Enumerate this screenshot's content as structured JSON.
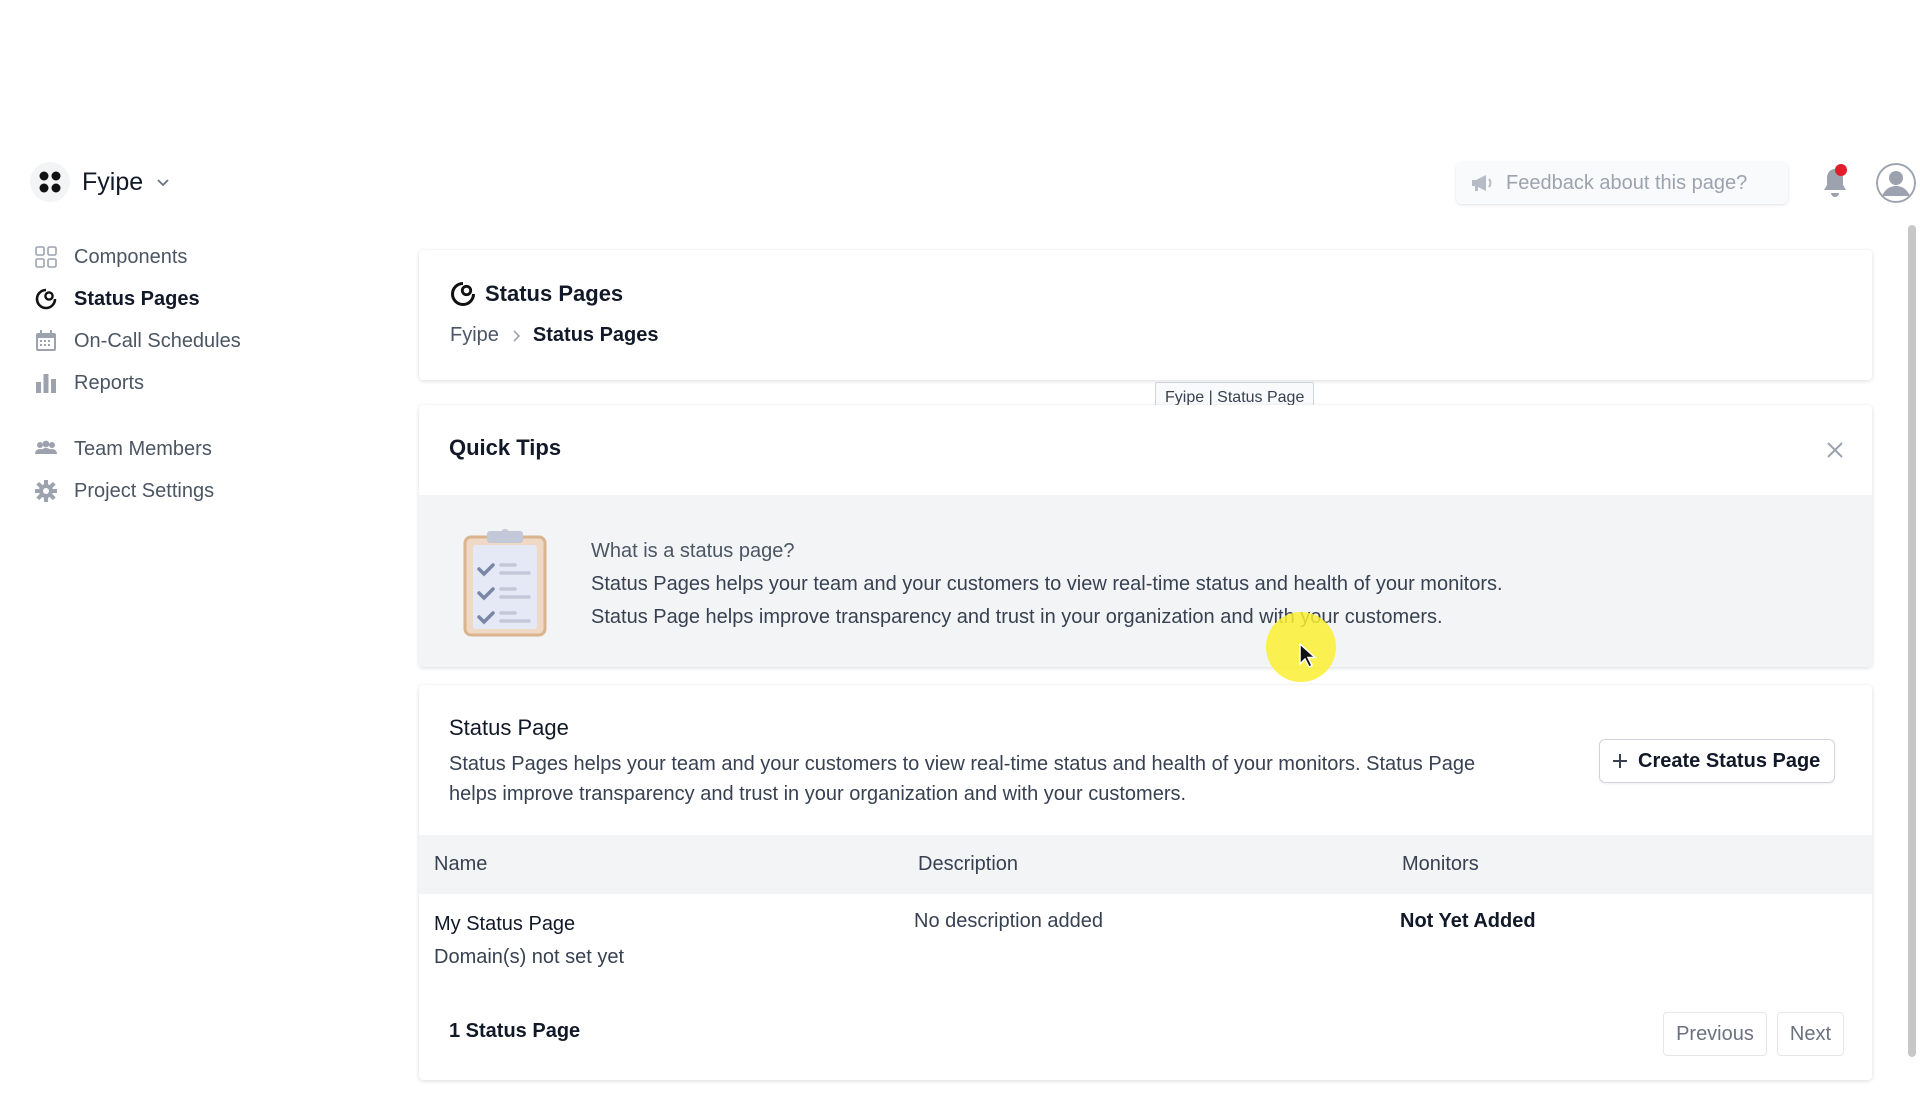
{
  "project": {
    "name": "Fyipe"
  },
  "sidebar": {
    "items": [
      {
        "label": "Components",
        "icon": "components-icon"
      },
      {
        "label": "Status Pages",
        "icon": "status-pages-icon",
        "active": true
      },
      {
        "label": "On-Call Schedules",
        "icon": "calendar-icon"
      },
      {
        "label": "Reports",
        "icon": "bar-chart-icon"
      }
    ],
    "items2": [
      {
        "label": "Team Members",
        "icon": "team-icon"
      },
      {
        "label": "Project Settings",
        "icon": "gear-icon"
      }
    ]
  },
  "header": {
    "feedback_placeholder": "Feedback about this page?"
  },
  "page": {
    "title": "Status Pages",
    "breadcrumb": [
      "Fyipe",
      "Status Pages"
    ],
    "tooltip": "Fyipe | Status Page"
  },
  "tips": {
    "title": "Quick Tips",
    "question": "What is a status page?",
    "line1": "Status Pages helps your team and your customers to view real-time status and health of your monitors.",
    "line2": "Status Page helps improve transparency and trust in your organization and with your customers."
  },
  "list": {
    "title": "Status Page",
    "description": "Status Pages helps your team and your customers to view real-time status and health of your monitors. Status Page helps improve transparency and trust in your organization and with your customers.",
    "create_label": "Create Status Page",
    "columns": [
      "Name",
      "Description",
      "Monitors"
    ],
    "rows": [
      {
        "name": "My Status Page",
        "domain": "Domain(s) not set yet",
        "description": "No description added",
        "monitors": "Not Yet Added"
      }
    ],
    "count_label": "1 Status Page",
    "prev_label": "Previous",
    "next_label": "Next"
  },
  "colors": {
    "notification_dot": "#e11d2e",
    "cursor_highlight": "#faf032"
  }
}
